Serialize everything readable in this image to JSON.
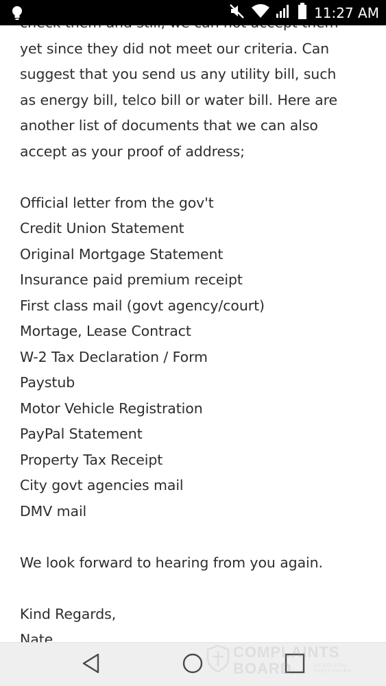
{
  "status_bar": {
    "time": "11:27 AM",
    "icons": [
      "lightbulb-icon",
      "mute-icon",
      "wifi-icon",
      "signal-icon",
      "battery-icon"
    ]
  },
  "message": {
    "lines": [
      "check them and still, we can not accept them",
      "yet since they did not meet our criteria. Can",
      "suggest that you send us any utility bill, such",
      "as energy bill, telco bill or water bill. Here are",
      "another list of documents that we can also",
      "accept as your proof of address;",
      "",
      "Official letter from the gov't",
      "Credit Union Statement",
      "Original Mortgage Statement",
      "Insurance paid premium receipt",
      "First class mail (govt agency/court)",
      "Mortage, Lease Contract",
      "W-2 Tax Declaration / Form",
      "Paystub",
      "Motor Vehicle Registration",
      "PayPal Statement",
      "Property Tax Receipt",
      "City govt agencies mail",
      "DMV mail",
      "",
      "We look forward to hearing from you again.",
      "",
      "Kind Regards,",
      "Nate"
    ]
  },
  "nav_bar": {
    "buttons": [
      "back-icon",
      "home-icon",
      "recents-icon"
    ]
  },
  "watermark": {
    "line1": "COMPLAINTS",
    "line2": "BOARD",
    "line3": "RESOLVING",
    "line4": "DISCLOSURE"
  }
}
